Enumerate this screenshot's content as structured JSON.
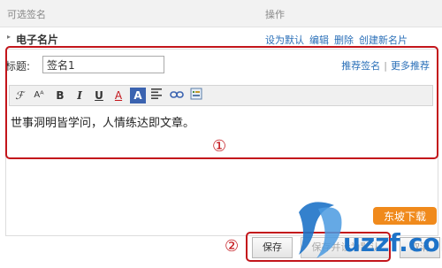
{
  "header": {
    "col_name": "可选签名",
    "col_ops": "操作"
  },
  "card": {
    "name": "电子名片",
    "ops": [
      "设为默认",
      "编辑",
      "删除",
      "创建新名片"
    ]
  },
  "editor": {
    "title_label": "标题:",
    "title_value": "签名1",
    "link_recommend": "推荐签名",
    "link_separator": "|",
    "link_more": "更多推荐",
    "content": "世事洞明皆学问，人情练达即文章。"
  },
  "toolbar": {
    "icons": [
      "font-family-icon",
      "font-size-icon",
      "bold-icon",
      "italic-icon",
      "underline-icon",
      "text-color-icon",
      "background-color-icon",
      "align-icon",
      "link-icon",
      "insert-image-icon"
    ],
    "bold_glyph": "B",
    "italic_glyph": "I",
    "underline_glyph": "U",
    "text_color_glyph": "A",
    "bg_color_glyph": "A",
    "font_glyph": "ℱ",
    "size_glyph": "Aᴬ"
  },
  "annotations": {
    "one": "①",
    "two": "②"
  },
  "buttons": {
    "save": "保存",
    "save_default": "保存并设为默认",
    "cancel": "取消"
  },
  "watermark": {
    "text": "uzzf.com",
    "badge": "东坡下载"
  },
  "colors": {
    "accent": "#c3151b",
    "link": "#2a6fb8",
    "watermark_blue": "#1e73c8",
    "watermark_orange": "#f08a1c"
  }
}
